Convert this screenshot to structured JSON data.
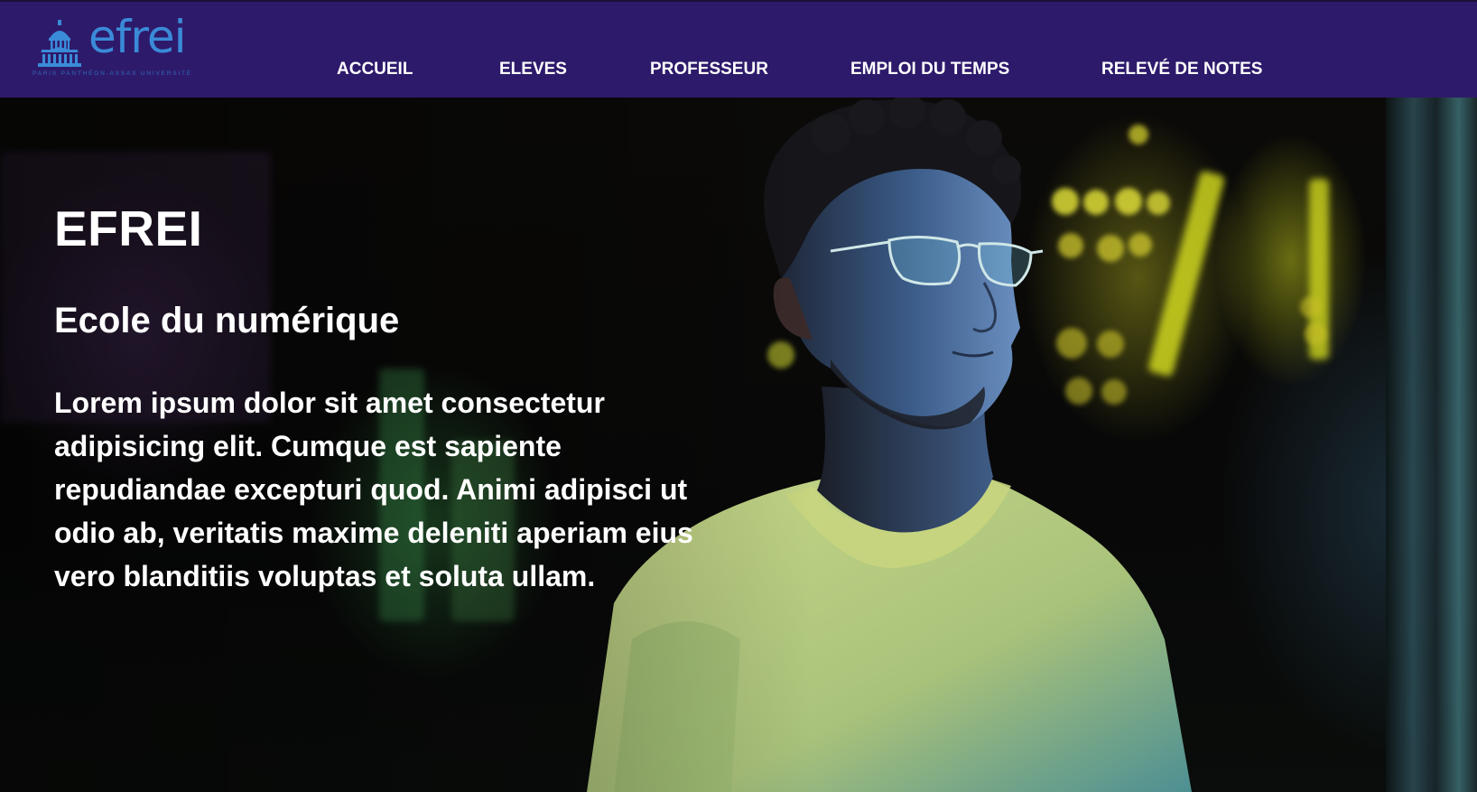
{
  "logo": {
    "name": "efrei",
    "tagline": "PARIS PANTHÉON-ASSAS UNIVERSITÉ"
  },
  "nav": {
    "items": [
      {
        "label": "ACCUEIL"
      },
      {
        "label": "ELEVES"
      },
      {
        "label": "PROFESSEUR"
      },
      {
        "label": "EMPLOI DU TEMPS"
      },
      {
        "label": "RELEVÉ DE NOTES"
      }
    ]
  },
  "hero": {
    "title": "EFREI",
    "subtitle": "Ecole du numérique",
    "paragraph": "Lorem ipsum dolor sit amet consectetur adipisicing elit. Cumque est sapiente repudiandae excepturi quod. Animi adipisci ut odio ab, veritatis maxime deleniti aperiam eius vero blanditiis voluptas et soluta ullam."
  },
  "colors": {
    "navbar_bg": "#2e1a6b",
    "logo_blue": "#3a8bd8",
    "text": "#ffffff"
  }
}
